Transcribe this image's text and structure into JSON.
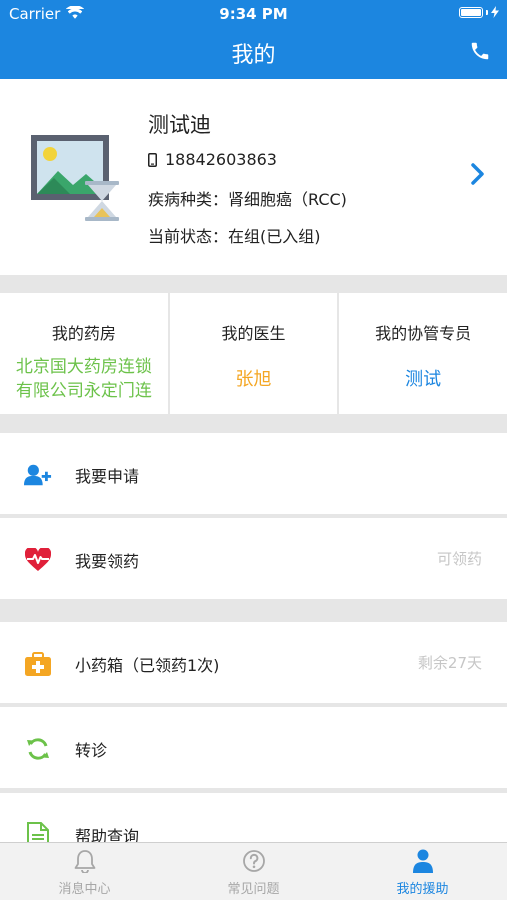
{
  "status_bar": {
    "carrier": "Carrier",
    "time": "9:34 PM"
  },
  "nav": {
    "title": "我的",
    "right_icon": "phone-icon"
  },
  "profile": {
    "name": "测试迪",
    "phone": "18842603863",
    "disease": "疾病种类：肾细胞癌（RCC)",
    "state": "当前状态：在组(已入组)"
  },
  "cards": [
    {
      "title": "我的药房",
      "value": "北京国大药房连锁有限公司永定门连",
      "value_line1": "北京国大药房连锁",
      "value_line2": "有限公司永定门连",
      "color": "#6cc24a"
    },
    {
      "title": "我的医生",
      "value": "张旭",
      "color": "#f4a623"
    },
    {
      "title": "我的协管专员",
      "value": "测试",
      "color": "#1c86e0"
    }
  ],
  "menu": [
    {
      "icon": "add-user-icon",
      "label": "我要申请",
      "right": ""
    },
    {
      "icon": "heartbeat-icon",
      "label": "我要领药",
      "right": "可领药"
    },
    {
      "icon": "medicine-kit-icon",
      "label": "小药箱（已领药1次)",
      "right": "剩余27天"
    },
    {
      "icon": "refresh-icon",
      "label": "转诊",
      "right": ""
    },
    {
      "icon": "document-icon",
      "label": "帮助查询",
      "right": ""
    }
  ],
  "tabs": [
    {
      "icon": "bell-icon",
      "label": "消息中心",
      "active": false
    },
    {
      "icon": "question-icon",
      "label": "常见问题",
      "active": false
    },
    {
      "icon": "person-icon",
      "label": "我的援助",
      "active": true
    }
  ],
  "colors": {
    "primary": "#1c86e0",
    "green": "#6cc24a",
    "orange": "#f4a623",
    "red": "#e0203a"
  }
}
